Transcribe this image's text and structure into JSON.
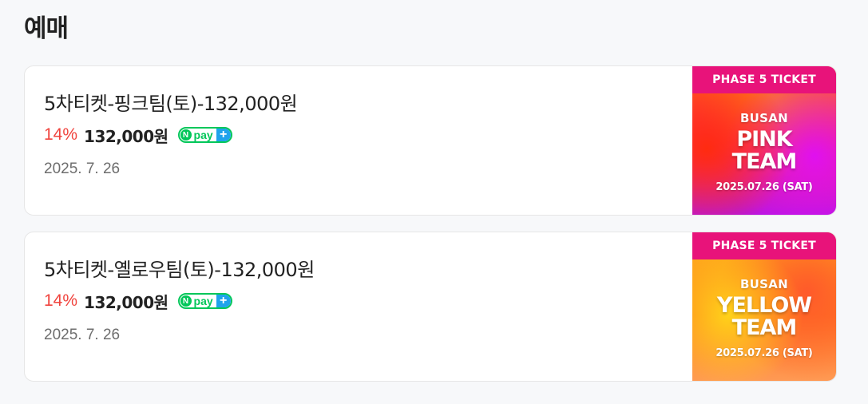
{
  "section_title": "예매",
  "products": [
    {
      "title": "5차티켓-핑크팀(토)-132,000원",
      "discount": "14%",
      "price": "132,000원",
      "npay": {
        "n": "N",
        "word": "pay",
        "plus": "+"
      },
      "date": "2025. 7. 26",
      "thumbnail": {
        "banner": "PHASE 5 TICKET",
        "city": "BUSAN",
        "team_line1": "PINK",
        "team_line2": "TEAM",
        "event_date": "2025.07.26 (SAT)"
      }
    },
    {
      "title": "5차티켓-옐로우팀(토)-132,000원",
      "discount": "14%",
      "price": "132,000원",
      "npay": {
        "n": "N",
        "word": "pay",
        "plus": "+"
      },
      "date": "2025. 7. 26",
      "thumbnail": {
        "banner": "PHASE 5 TICKET",
        "city": "BUSAN",
        "team_line1": "YELLOW",
        "team_line2": "TEAM",
        "event_date": "2025.07.26 (SAT)"
      }
    }
  ],
  "colors": {
    "discount": "#f0443e",
    "npay_green": "#03c75a",
    "npay_blue": "#1fa3ec",
    "banner": "#e8137a"
  }
}
